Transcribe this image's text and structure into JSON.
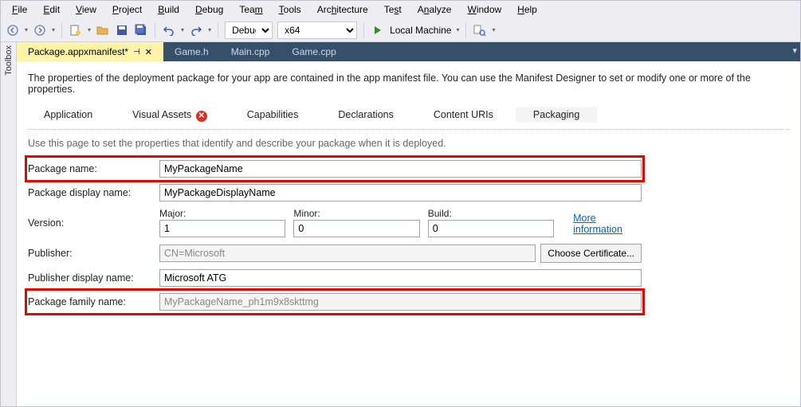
{
  "menu": {
    "file": "File",
    "edit": "Edit",
    "view": "View",
    "project": "Project",
    "build": "Build",
    "debug": "Debug",
    "team": "Team",
    "tools": "Tools",
    "architecture": "Architecture",
    "test": "Test",
    "analyze": "Analyze",
    "window": "Window",
    "help": "Help"
  },
  "toolbar": {
    "config": "Debug",
    "platform": "x64",
    "run": "Local Machine"
  },
  "toolbox_label": "Toolbox",
  "tabs": [
    {
      "label": "Package.appxmanifest*",
      "active": true
    },
    {
      "label": "Game.h",
      "active": false
    },
    {
      "label": "Main.cpp",
      "active": false
    },
    {
      "label": "Game.cpp",
      "active": false
    }
  ],
  "panel": {
    "description": "The properties of the deployment package for your app are contained in the app manifest file. You can use the Manifest Designer to set or modify one or more of the properties.",
    "categories": [
      "Application",
      "Visual Assets",
      "Capabilities",
      "Declarations",
      "Content URIs",
      "Packaging"
    ],
    "active_category": "Packaging",
    "error_category": "Visual Assets",
    "hint": "Use this page to set the properties that identify and describe your package when it is deployed.",
    "fields": {
      "package_name_label": "Package name:",
      "package_name": "MyPackageName",
      "package_display_label": "Package display name:",
      "package_display": "MyPackageDisplayName",
      "version_label": "Version:",
      "major_label": "Major:",
      "major": "1",
      "minor_label": "Minor:",
      "minor": "0",
      "build_label": "Build:",
      "build": "0",
      "more_info": "More information",
      "publisher_label": "Publisher:",
      "publisher": "CN=Microsoft",
      "choose_cert": "Choose Certificate...",
      "publisher_display_label": "Publisher display name:",
      "publisher_display": "Microsoft ATG",
      "family_label": "Package family name:",
      "family": "MyPackageName_ph1m9x8skttmg"
    }
  }
}
